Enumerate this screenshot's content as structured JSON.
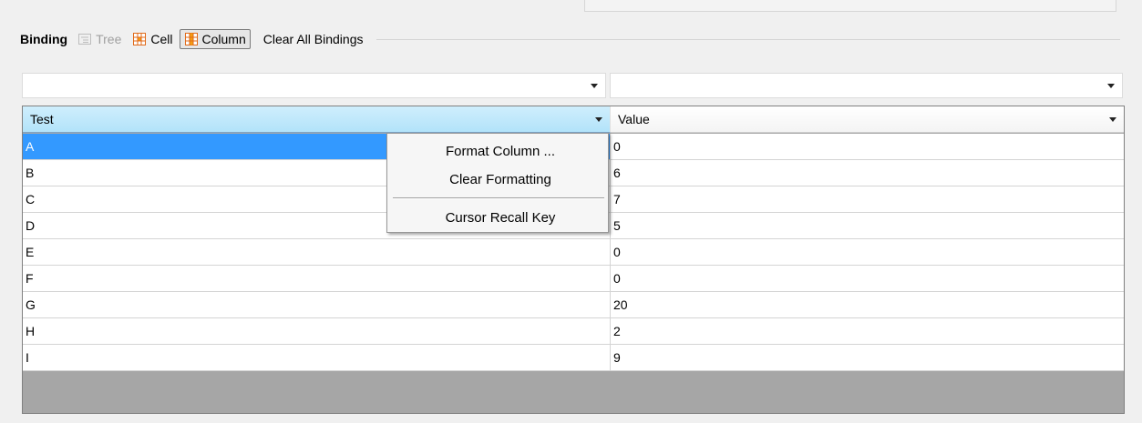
{
  "binding": {
    "title": "Binding",
    "tree_label": "Tree",
    "cell_label": "Cell",
    "column_label": "Column",
    "clear_all_label": "Clear All Bindings"
  },
  "filters": {
    "test_value": "",
    "value_value": ""
  },
  "table": {
    "columns": [
      "Test",
      "Value"
    ],
    "rows": [
      {
        "test": "A",
        "value": "0"
      },
      {
        "test": "B",
        "value": "6"
      },
      {
        "test": "C",
        "value": "7"
      },
      {
        "test": "D",
        "value": "5"
      },
      {
        "test": "E",
        "value": "0"
      },
      {
        "test": "F",
        "value": "0"
      },
      {
        "test": "G",
        "value": "20"
      },
      {
        "test": "H",
        "value": "2"
      },
      {
        "test": "I",
        "value": "9"
      }
    ],
    "selected_row": 0
  },
  "context_menu": {
    "items": [
      "Format Column ...",
      "Clear Formatting",
      "Cursor Recall Key"
    ]
  },
  "colors": {
    "header_selected": "#b2e3fa",
    "row_selected": "#3399ff",
    "empty_area": "#a6a6a6"
  }
}
